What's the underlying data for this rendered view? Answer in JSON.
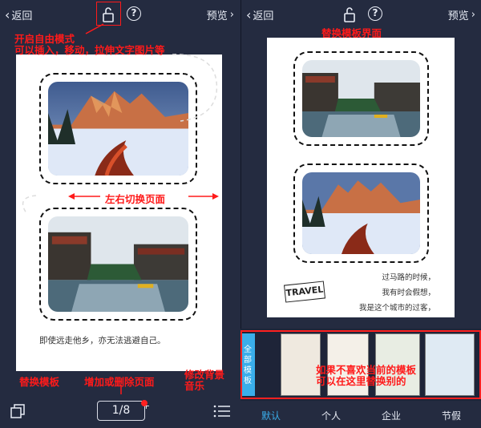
{
  "top": {
    "back_label": "返回",
    "preview_label": "预览"
  },
  "left": {
    "caption": "即使远走他乡，亦无法逃避自己。",
    "page_indicator": "1/8",
    "plus": "+",
    "annotations": {
      "free_mode_title": "开启自由模式",
      "free_mode_desc": "可以插入，移动，拉伸文字图片等",
      "swipe": "左右切换页面",
      "replace_template": "替换模板",
      "add_delete": "增加或删除页面",
      "bg_music_1": "修改背景",
      "bg_music_2": "音乐"
    }
  },
  "right": {
    "poem": [
      "过马路的时候，",
      "我有时会假想，",
      "我是这个城市的过客，"
    ],
    "sticker": "TRAVEL",
    "all_templates_label": "全部模板",
    "tabs": [
      "默认",
      "个人",
      "企业",
      "节假"
    ],
    "annotations": {
      "replace_screen": "替换模板界面",
      "hint_1": "如果不喜欢当前的模板",
      "hint_2": "可以在这里替换别的"
    }
  }
}
